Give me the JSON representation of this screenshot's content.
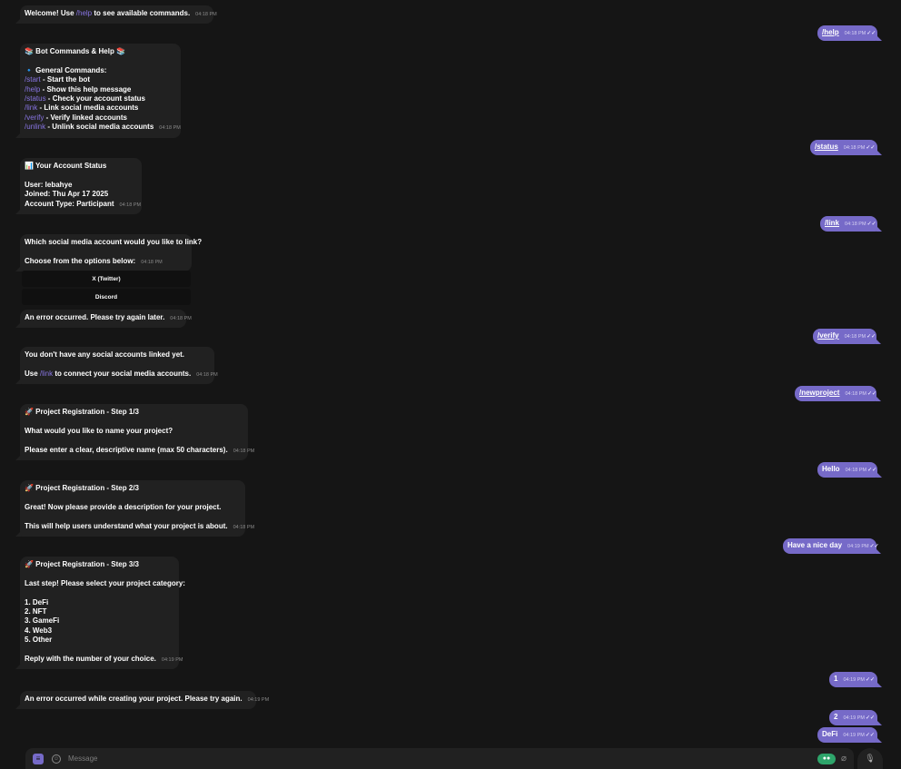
{
  "incoming": [
    {
      "lines": [
        [
          {
            "t": "Welcome! Use "
          },
          {
            "t": "/help",
            "c": 1
          },
          {
            "t": " to see available commands."
          }
        ]
      ],
      "time": "04:18 PM"
    },
    {
      "lines": [
        [
          {
            "t": "📚 Bot Commands & Help 📚"
          }
        ],
        [],
        [
          {
            "t": "🔹 General Commands:"
          }
        ],
        [
          {
            "t": "/start",
            "c": 1
          },
          {
            "t": " - Start the bot"
          }
        ],
        [
          {
            "t": "/help",
            "c": 1
          },
          {
            "t": " - Show this help message"
          }
        ],
        [
          {
            "t": "/status",
            "c": 1
          },
          {
            "t": " - Check your account status"
          }
        ],
        [
          {
            "t": "/link",
            "c": 1
          },
          {
            "t": " - Link social media accounts"
          }
        ],
        [
          {
            "t": "/verify",
            "c": 1
          },
          {
            "t": " - Verify linked accounts"
          }
        ],
        [
          {
            "t": "/unlink",
            "c": 1
          },
          {
            "t": " - Unlink social media accounts"
          }
        ]
      ],
      "time": "04:18 PM"
    },
    {
      "lines": [
        [
          {
            "t": "📊 Your Account Status"
          }
        ],
        [],
        [
          {
            "t": "User: lebahye"
          }
        ],
        [
          {
            "t": "Joined: Thu Apr 17 2025"
          }
        ],
        [
          {
            "t": "Account Type: Participant"
          }
        ]
      ],
      "time": "04:18 PM"
    },
    {
      "lines": [
        [
          {
            "t": "Which social media account would you like to link?"
          }
        ],
        [],
        [
          {
            "t": "Choose from the options below:"
          }
        ]
      ],
      "time": "04:18 PM"
    },
    {
      "lines": [
        [
          {
            "t": "An error occurred. Please try again later."
          }
        ]
      ],
      "time": "04:18 PM"
    },
    {
      "lines": [
        [
          {
            "t": "You don't have any social accounts linked yet."
          }
        ],
        [],
        [
          {
            "t": "Use "
          },
          {
            "t": "/link",
            "c": 1
          },
          {
            "t": " to connect your social media accounts."
          }
        ]
      ],
      "time": "04:18 PM"
    },
    {
      "lines": [
        [
          {
            "t": "🚀 Project Registration - Step 1/3"
          }
        ],
        [],
        [
          {
            "t": "What would you like to name your project?"
          }
        ],
        [],
        [
          {
            "t": "Please enter a clear, descriptive name (max 50 characters)."
          }
        ]
      ],
      "time": "04:18 PM"
    },
    {
      "lines": [
        [
          {
            "t": "🚀 Project Registration - Step 2/3"
          }
        ],
        [],
        [
          {
            "t": "Great! Now please provide a description for your project."
          }
        ],
        [],
        [
          {
            "t": "This will help users understand what your project is about."
          }
        ]
      ],
      "time": "04:18 PM"
    },
    {
      "lines": [
        [
          {
            "t": "🚀 Project Registration - Step 3/3"
          }
        ],
        [],
        [
          {
            "t": "Last step! Please select your project category:"
          }
        ],
        [],
        [
          {
            "t": "1. DeFi"
          }
        ],
        [
          {
            "t": "2. NFT"
          }
        ],
        [
          {
            "t": "3. GameFi"
          }
        ],
        [
          {
            "t": "4. Web3"
          }
        ],
        [
          {
            "t": "5. Other"
          }
        ],
        [],
        [
          {
            "t": "Reply with the number of your choice."
          }
        ]
      ],
      "time": "04:19 PM"
    },
    {
      "lines": [
        [
          {
            "t": "An error occurred while creating your project. Please try again."
          }
        ]
      ],
      "time": "04:19 PM"
    }
  ],
  "keyboard": [
    "X (Twitter)",
    "Discord"
  ],
  "outgoing": [
    {
      "text": "/help",
      "cmd": true,
      "time": "04:18 PM"
    },
    {
      "text": "/status",
      "cmd": true,
      "time": "04:18 PM"
    },
    {
      "text": "/link",
      "cmd": true,
      "time": "04:18 PM"
    },
    {
      "text": "/verify",
      "cmd": true,
      "time": "04:18 PM"
    },
    {
      "text": "/newproject",
      "cmd": true,
      "time": "04:18 PM"
    },
    {
      "text": "Hello",
      "cmd": false,
      "time": "04:18 PM"
    },
    {
      "text": "Have a nice day",
      "cmd": false,
      "time": "04:19 PM"
    },
    {
      "text": "1",
      "cmd": false,
      "time": "04:19 PM"
    },
    {
      "text": "2",
      "cmd": false,
      "time": "04:19 PM"
    },
    {
      "text": "DeFi",
      "cmd": false,
      "time": "04:19 PM"
    }
  ],
  "composer": {
    "placeholder": "Message"
  },
  "icons": {
    "menu": "bot-menu-icon",
    "emoji": "emoji-icon",
    "attach": "paperclip-icon",
    "mic": "microphone-icon",
    "read": "double-check-icon"
  },
  "colors": {
    "background": "#151515",
    "incoming": "#212121",
    "outgoing": "#766ac8",
    "command": "#8774e1"
  }
}
